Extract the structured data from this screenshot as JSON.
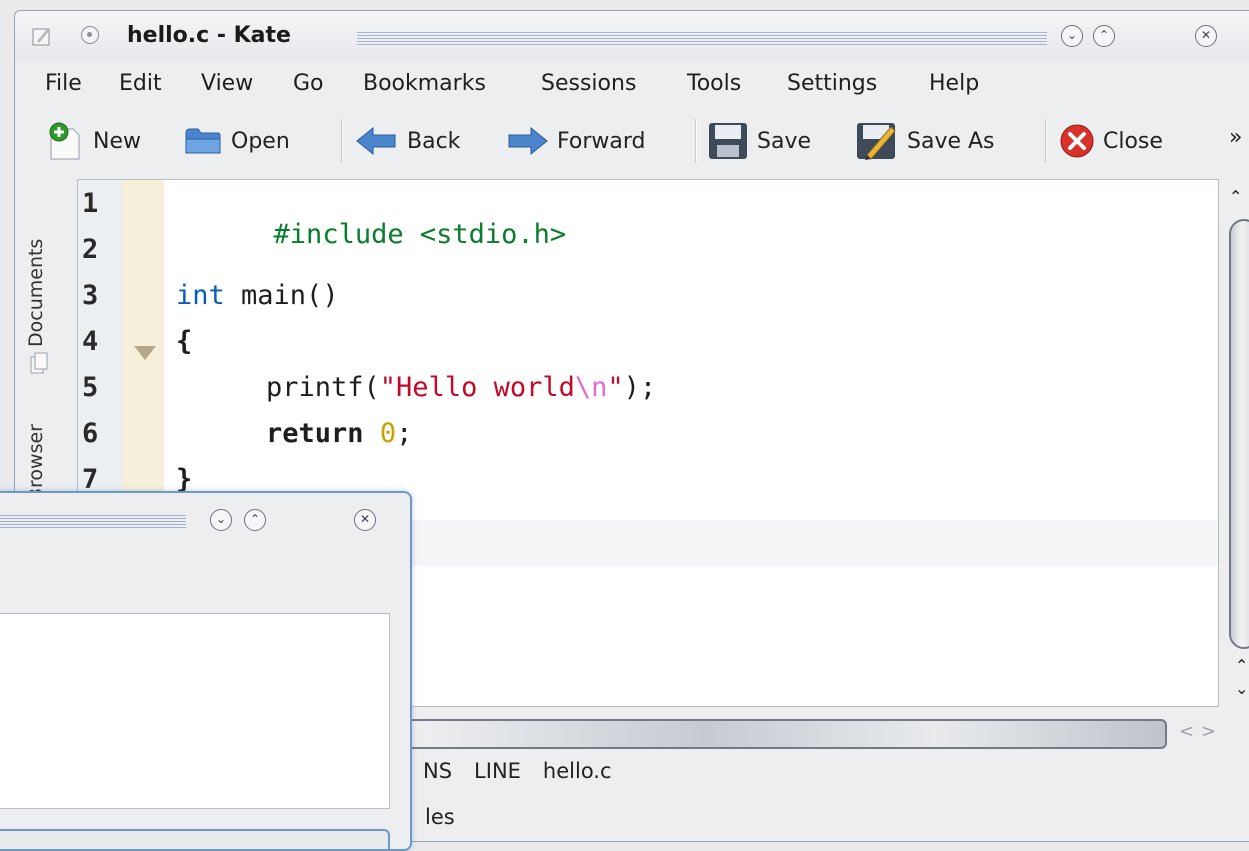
{
  "window": {
    "title": "hello.c - Kate"
  },
  "menu": [
    "File",
    "Edit",
    "View",
    "Go",
    "Bookmarks",
    "Sessions",
    "Tools",
    "Settings",
    "Help"
  ],
  "toolbar": {
    "new": "New",
    "open": "Open",
    "back": "Back",
    "forward": "Forward",
    "save": "Save",
    "save_as": "Save As",
    "close": "Close",
    "more": "»"
  },
  "sidebar": {
    "tabs": [
      "Documents",
      "Browser"
    ]
  },
  "editor": {
    "line_numbers": [
      "1",
      "2",
      "3",
      "4",
      "5",
      "6",
      "7"
    ],
    "lines": {
      "l1": "#include <stdio.h>",
      "l3_kw": "int",
      "l3_rest": " main()",
      "l4": "{",
      "l5_fn": "printf(",
      "l5_str1": "\"Hello world",
      "l5_esc": "\\n",
      "l5_str2": "\"",
      "l5_end": ");",
      "l6_kw": "return",
      "l6_num": "0",
      "l6_end": ";",
      "l7": "}"
    }
  },
  "statusbar": {
    "mode_partial": "NS",
    "line_label": "LINE",
    "filename": "hello.c",
    "second_partial": "les"
  },
  "icons": {
    "accent": "#0a5db5",
    "string": "#c10a28",
    "preprocessor": "#0a7d2c",
    "number": "#c9a000"
  }
}
